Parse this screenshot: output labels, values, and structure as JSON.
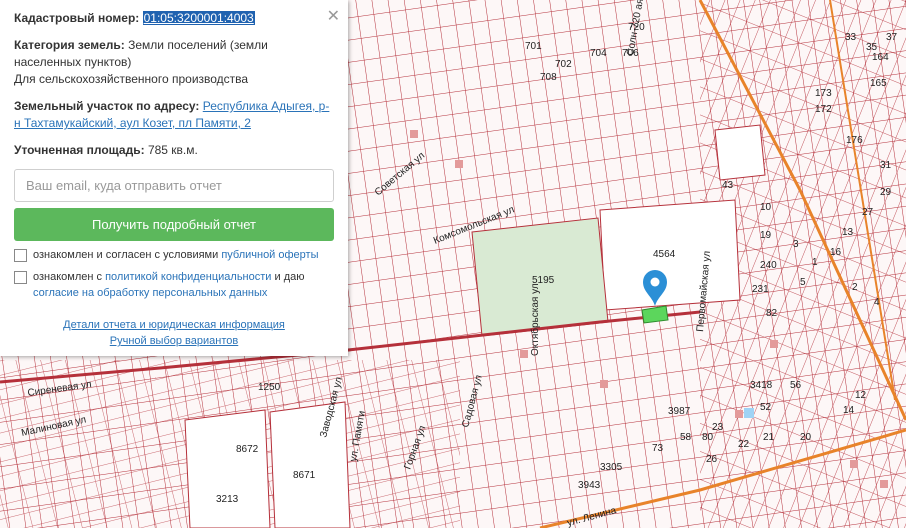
{
  "panel": {
    "cadastral_label": "Кадастровый номер:",
    "cadastral_number": "01:05:3200001:4003",
    "category_label": "Категория земель:",
    "category_value": "Земли поселений (земли населенных пунктов)",
    "usage": "Для сельскохозяйственного производства",
    "address_label": "Земельный участок по адресу:",
    "address_value": "Республика Адыгея, р-н Тахтамукайский, аул Козет, пл Памяти, 2",
    "area_label": "Уточненная площадь:",
    "area_value": "785 кв.м.",
    "email_placeholder": "Ваш email, куда отправить отчет",
    "submit_label": "Получить подробный отчет",
    "agree1_text": "ознакомлен и согласен с условиями ",
    "agree1_link": "публичной оферты",
    "agree2_text": "ознакомлен с ",
    "agree2_link": "политикой конфиденциальности",
    "agree2_mid": " и даю ",
    "agree2_link2": "согласие на обработку персональных данных",
    "details_link": "Детали отчета и юридическая информация",
    "manual_link": "Ручной выбор вариантов"
  },
  "map": {
    "parcel_labels": [
      "5195",
      "4564",
      "3418",
      "3987",
      "8672",
      "8671",
      "3213",
      "1250",
      "3305",
      "3943",
      "22",
      "21",
      "20",
      "14",
      "12",
      "52",
      "56",
      "23",
      "73",
      "58",
      "80",
      "26",
      "240",
      "231",
      "82",
      "5",
      "3",
      "19",
      "16",
      "13",
      "27",
      "29",
      "31",
      "173",
      "172",
      "165",
      "164",
      "176",
      "701",
      "704",
      "706",
      "708",
      "720",
      "702",
      "43",
      "10",
      "1",
      "2",
      "4",
      "33",
      "35",
      "37"
    ],
    "street_labels": [
      "Советская ул",
      "Комсомольская ул",
      "ул. Ленина",
      "Малиновая ул",
      "Сиреневая ул",
      "Солн-720 ая ул",
      "Садовая ул",
      "Октябрьская ул",
      "Заводская ул",
      "Горная ул",
      "Первомайская ул",
      "ул. Памяти"
    ],
    "marker_icon": "map-pin-icon",
    "colors": {
      "parcel_line": "#b22222",
      "park": "#d9ead3",
      "highlight": "#5cd65c",
      "road": "#e8832a",
      "marker": "#2b8fd6"
    }
  }
}
